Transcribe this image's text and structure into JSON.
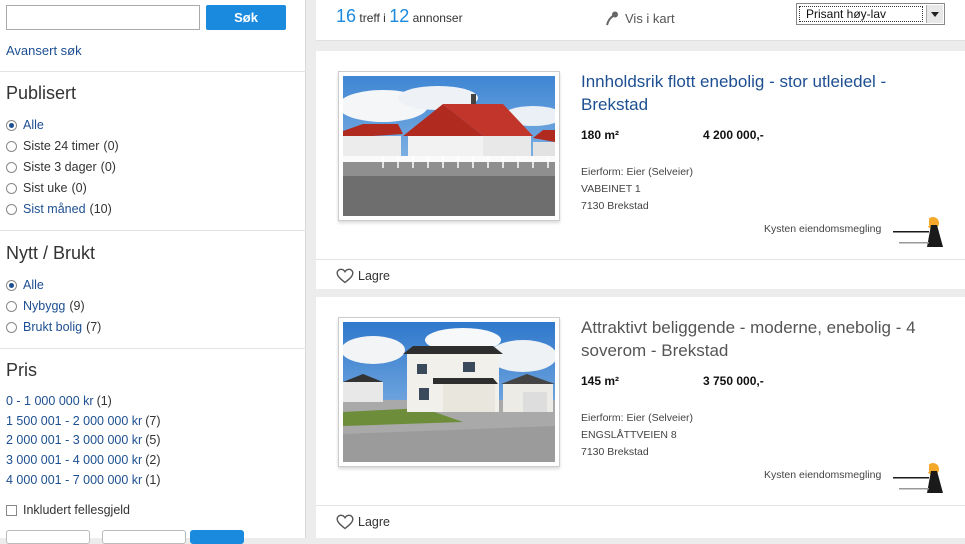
{
  "search": {
    "placeholder": "",
    "button": "Søk",
    "advanced": "Avansert søk"
  },
  "published": {
    "title": "Publisert",
    "options": [
      {
        "label": "Alle",
        "count": "",
        "checked": true,
        "link": false
      },
      {
        "label": "Siste 24 timer",
        "count": "(0)",
        "checked": false,
        "link": false
      },
      {
        "label": "Siste 3 dager",
        "count": "(0)",
        "checked": false,
        "link": false
      },
      {
        "label": "Sist uke",
        "count": "(0)",
        "checked": false,
        "link": false
      },
      {
        "label": "Sist måned",
        "count": "(10)",
        "checked": false,
        "link": true
      }
    ]
  },
  "condition": {
    "title": "Nytt / Brukt",
    "options": [
      {
        "label": "Alle",
        "count": "",
        "checked": true,
        "link": false
      },
      {
        "label": "Nybygg",
        "count": "(9)",
        "checked": false,
        "link": true
      },
      {
        "label": "Brukt bolig",
        "count": "(7)",
        "checked": false,
        "link": true
      }
    ]
  },
  "price_filter": {
    "title": "Pris",
    "ranges": [
      {
        "label": "0 - 1 000 000 kr",
        "count": "(1)"
      },
      {
        "label": "1 500 001 - 2 000 000 kr",
        "count": "(7)"
      },
      {
        "label": "2 000 001 - 3 000 000 kr",
        "count": "(5)"
      },
      {
        "label": "3 000 001 - 4 000 000 kr",
        "count": "(2)"
      },
      {
        "label": "4 000 001 - 7 000 000 kr",
        "count": "(1)"
      }
    ],
    "include_label": "Inkludert fellesgjeld"
  },
  "results": {
    "hits": "16",
    "hits_text": "treff i",
    "ads": "12",
    "ads_text": "annonser",
    "map_link": "Vis i kart",
    "sort_selected": "Prisant høy-lav"
  },
  "listings": [
    {
      "title": "Innholdsrik flott enebolig - stor utleiedel - Brekstad",
      "area": "180 m²",
      "price": "4 200 000,-",
      "ownership": "Eierform: Eier (Selveier)",
      "street": "VABEINET 1",
      "city": "7130 Brekstad",
      "broker": "Kysten eiendomsmegling",
      "save": "Lagre"
    },
    {
      "title": "Attraktivt beliggende - moderne, enebolig - 4 soverom - Brekstad",
      "area": "145 m²",
      "price": "3 750 000,-",
      "ownership": "Eierform: Eier (Selveier)",
      "street": "ENGSLÅTTVEIEN 8",
      "city": "7130 Brekstad",
      "broker": "Kysten eiendomsmegling",
      "save": "Lagre"
    }
  ],
  "colors": {
    "accent": "#1a8ade",
    "link": "#1d4f91"
  },
  "icons": [
    "map-pin-icon",
    "heart-icon",
    "radio-icon",
    "checkbox-icon",
    "dropdown-arrow-icon"
  ]
}
